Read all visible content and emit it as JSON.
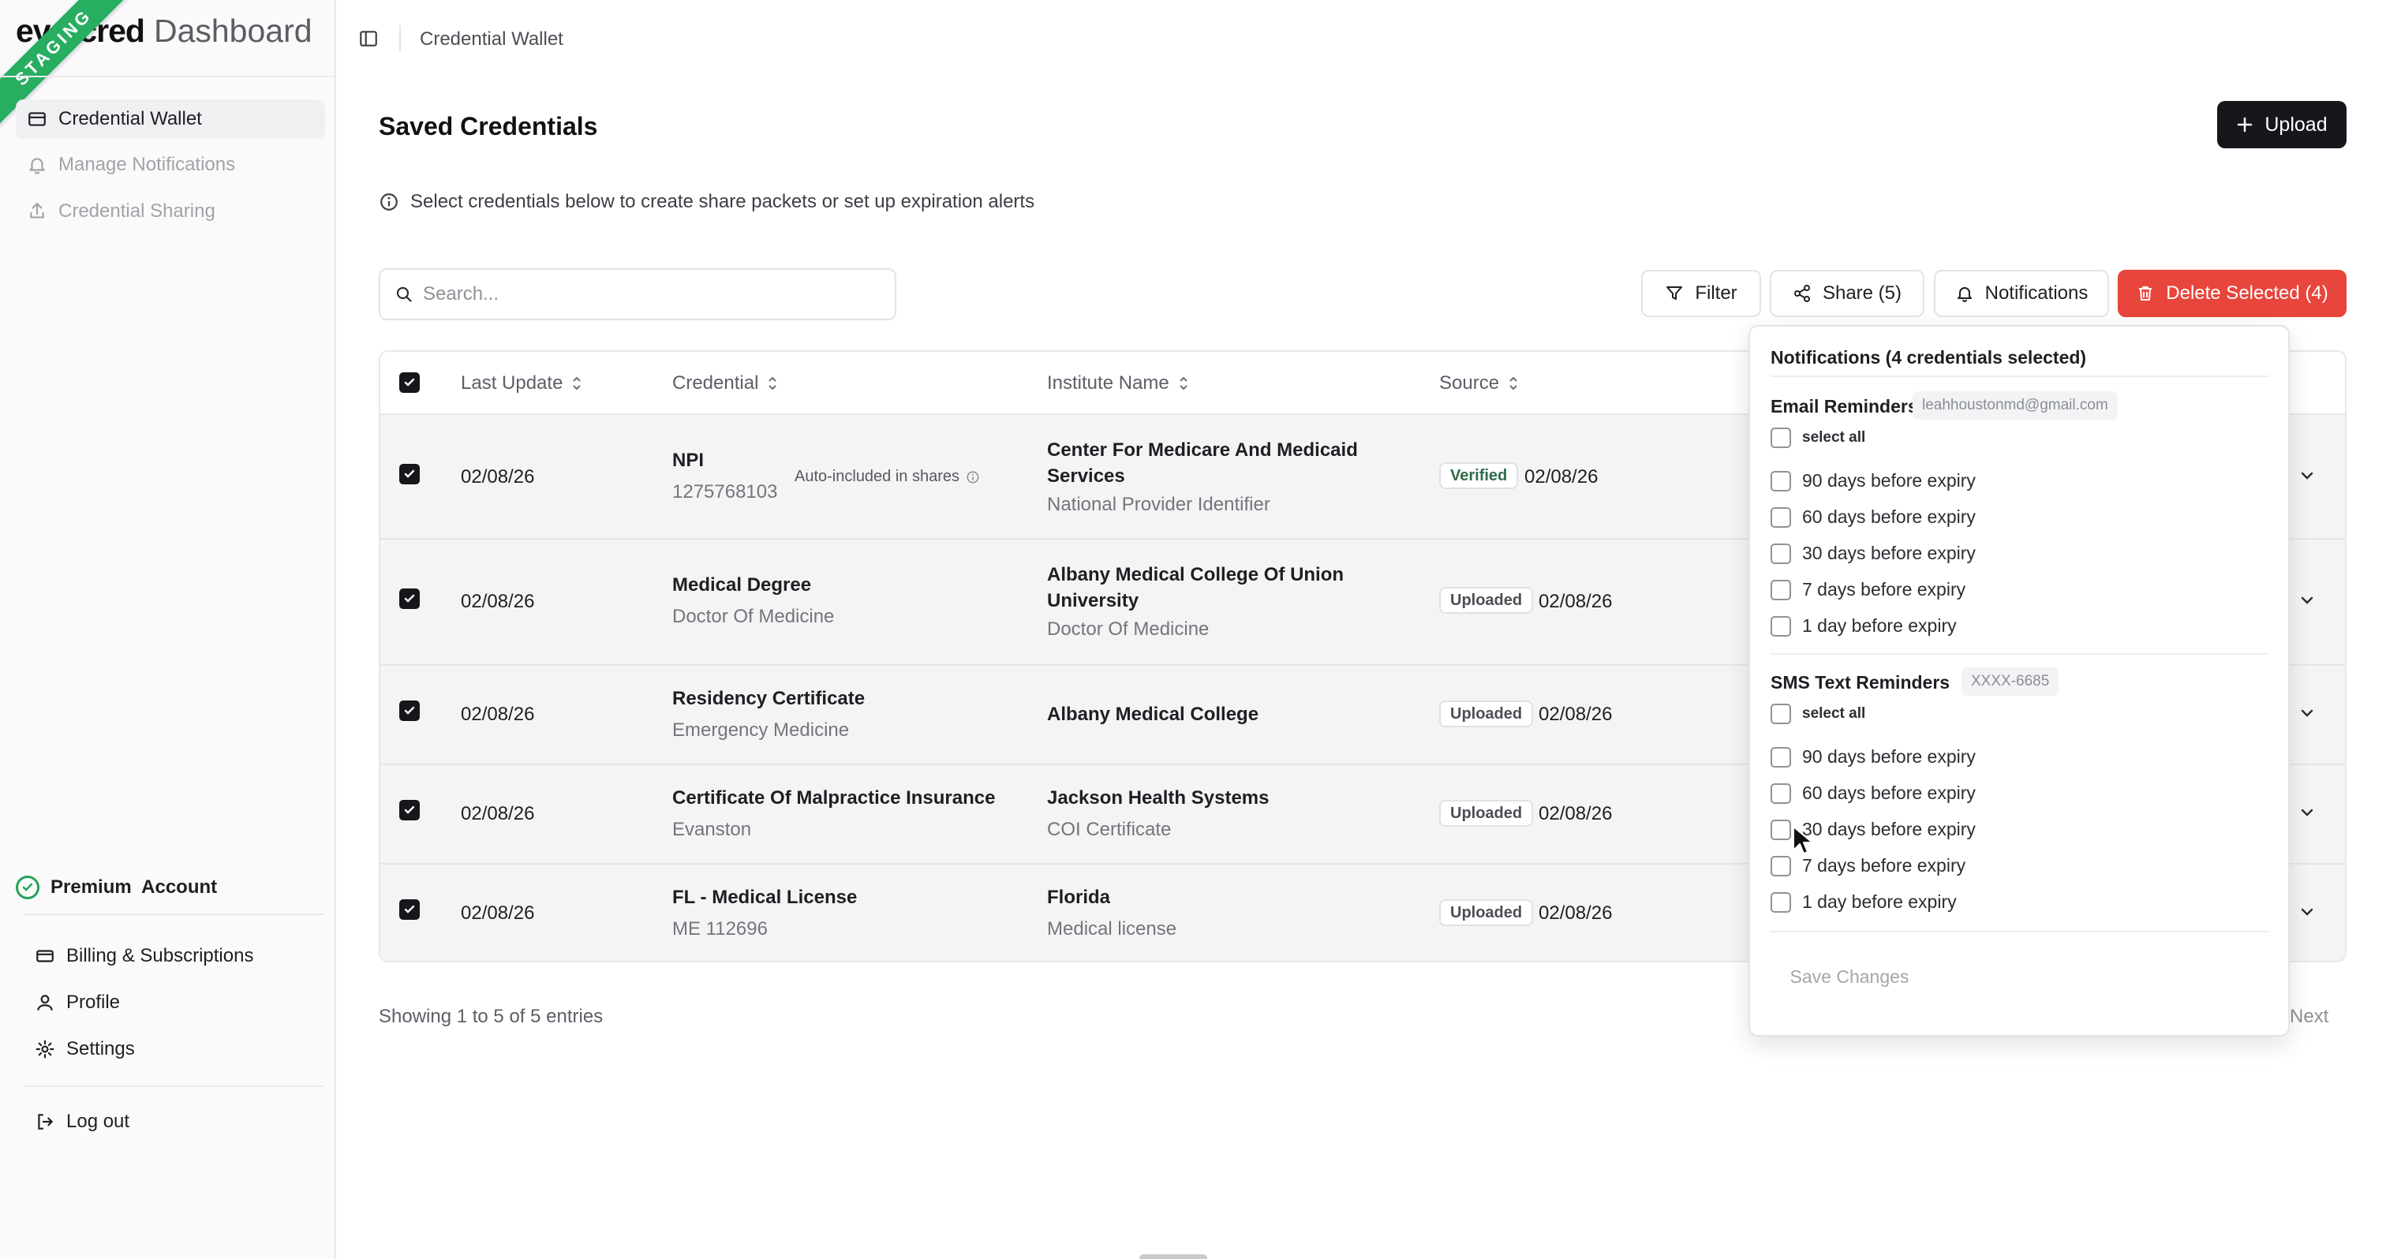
{
  "brand": {
    "name": "evercred",
    "suffix": "Dashboard",
    "env_ribbon": "STAGING"
  },
  "sidebar": {
    "items": [
      {
        "label": "Credential Wallet",
        "icon": "wallet-icon",
        "active": true
      },
      {
        "label": "Manage Notifications",
        "icon": "bell-icon",
        "active": false
      },
      {
        "label": "Credential Sharing",
        "icon": "share-icon",
        "active": false
      }
    ],
    "account_status": "Premium  Account",
    "bottom_items": [
      {
        "label": "Billing & Subscriptions",
        "icon": "credit-card-icon"
      },
      {
        "label": "Profile",
        "icon": "user-icon"
      },
      {
        "label": "Settings",
        "icon": "gear-icon"
      }
    ],
    "logout_label": "Log out"
  },
  "topbar": {
    "breadcrumb": "Credential Wallet"
  },
  "main": {
    "title": "Saved Credentials",
    "upload_label": "Upload",
    "info_text": "Select credentials below to create share packets or set up expiration alerts",
    "search_placeholder": "Search...",
    "toolbar": {
      "filter_label": "Filter",
      "share_label": "Share (5)",
      "notifications_label": "Notifications",
      "delete_label": "Delete Selected (4)"
    },
    "columns": [
      "Last Update",
      "Credential",
      "Institute Name",
      "Source"
    ],
    "rows": [
      {
        "date": "02/08/26",
        "credential": "NPI",
        "credential_sub": "1275768103",
        "note": "Auto-included in shares",
        "institute": "Center For Medicare And Medicaid Services",
        "institute_sub": "National Provider Identifier",
        "source": "Verified",
        "source_date": "02/08/26",
        "checked": true
      },
      {
        "date": "02/08/26",
        "credential": "Medical Degree",
        "credential_sub": "Doctor Of Medicine",
        "institute": "Albany Medical College Of Union University",
        "institute_sub": "Doctor Of Medicine",
        "source": "Uploaded",
        "source_date": "02/08/26",
        "checked": true
      },
      {
        "date": "02/08/26",
        "credential": "Residency Certificate",
        "credential_sub": "Emergency Medicine",
        "institute": "Albany Medical College",
        "institute_sub": "",
        "source": "Uploaded",
        "source_date": "02/08/26",
        "checked": true
      },
      {
        "date": "02/08/26",
        "credential": "Certificate Of Malpractice Insurance",
        "credential_sub": "Evanston",
        "institute": "Jackson Health Systems",
        "institute_sub": "COI Certificate",
        "source": "Uploaded",
        "source_date": "02/08/26",
        "checked": true
      },
      {
        "date": "02/08/26",
        "credential": "FL - Medical License",
        "credential_sub": "ME 112696",
        "institute": "Florida",
        "institute_sub": "Medical license",
        "source": "Uploaded",
        "source_date": "02/08/26",
        "checked": true
      }
    ],
    "footer": {
      "showing": "Showing 1 to 5 of 5 entries",
      "next_label": "Next"
    }
  },
  "notifications_popover": {
    "title": "Notifications (4 credentials selected)",
    "email": {
      "title": "Email Reminders",
      "address": "leahhoustonmd@gmail.com",
      "select_all": "select all",
      "options": [
        "90 days before expiry",
        "60 days before expiry",
        "30 days before expiry",
        "7 days before expiry",
        "1 day before expiry"
      ]
    },
    "sms": {
      "title": "SMS Text Reminders",
      "number": "XXXX-6685",
      "select_all": "select all",
      "options": [
        "90 days before expiry",
        "60 days before expiry",
        "30 days before expiry",
        "7 days before expiry",
        "1 day before expiry"
      ]
    },
    "save_label": "Save Changes"
  },
  "colors": {
    "accent_dark": "#15171b",
    "danger": "#e8453c",
    "staging_green": "#27ae60",
    "premium_green": "#22a45a"
  }
}
